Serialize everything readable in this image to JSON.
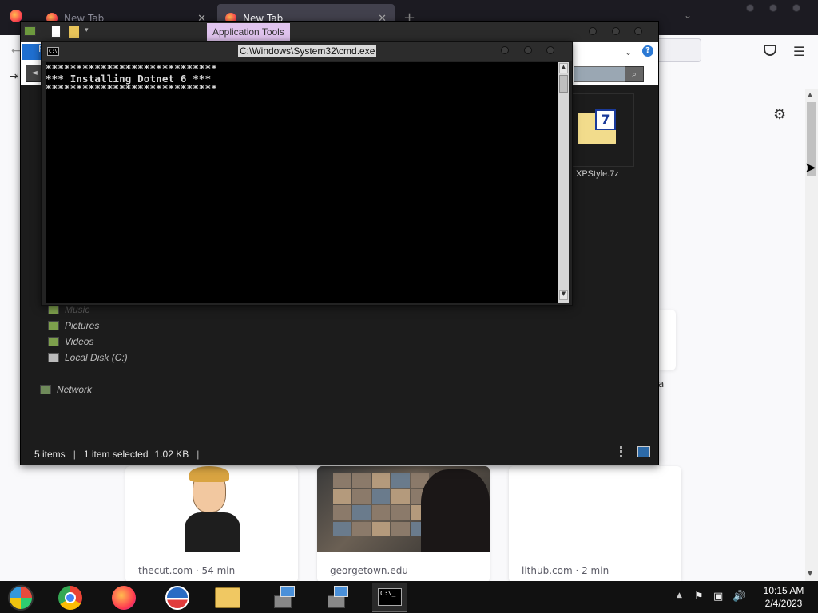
{
  "firefox": {
    "tabs": [
      {
        "label": "New Tab",
        "active": false
      },
      {
        "label": "New Tab",
        "active": true
      }
    ],
    "new_tab_symbol": "+",
    "tile_partial_label": "a",
    "stories": [
      {
        "source": "thecut.com",
        "read_time": "54 min"
      },
      {
        "source": "georgetown.edu",
        "read_time": ""
      },
      {
        "source": "lithub.com",
        "read_time": "2 min"
      }
    ]
  },
  "explorer": {
    "qat_arrow": "▾",
    "context_tab": "Application Tools",
    "file_tab_label": "F",
    "help_symbol": "?",
    "file_item": {
      "name": "XPStyle.7z",
      "badge": "7",
      "icon": "7zip-archive-icon"
    },
    "nav_items": [
      {
        "label": "Music",
        "icon": "music-folder-icon"
      },
      {
        "label": "Pictures",
        "icon": "pictures-folder-icon"
      },
      {
        "label": "Videos",
        "icon": "videos-folder-icon"
      },
      {
        "label": "Local Disk (C:)",
        "icon": "local-disk-icon"
      },
      {
        "label": "Network",
        "icon": "network-icon"
      }
    ],
    "status": {
      "items": "5 items",
      "selected": "1 item selected",
      "size": "1.02 KB",
      "separator": "|"
    }
  },
  "cmd": {
    "title": "C:\\Windows\\System32\\cmd.exe",
    "icon_text": "C:\\",
    "lines": [
      "****************************",
      "*** Installing Dotnet 6 ***",
      "****************************"
    ]
  },
  "taskbar": {
    "apps": [
      {
        "name": "Start",
        "icon": "windows-orb-icon"
      },
      {
        "name": "Chrome",
        "icon": "chrome-icon"
      },
      {
        "name": "Firefox",
        "icon": "firefox-icon"
      },
      {
        "name": "App",
        "icon": "app-icon"
      },
      {
        "name": "File Explorer",
        "icon": "folder-icon"
      },
      {
        "name": "Installer",
        "icon": "installer-icon"
      },
      {
        "name": "Installer",
        "icon": "installer-icon"
      },
      {
        "name": "Command Prompt",
        "icon": "cmd-icon",
        "active": true
      }
    ],
    "cmd_icon_text": "C:\\_",
    "clock": {
      "time": "10:15 AM",
      "date": "2/4/2023"
    }
  }
}
